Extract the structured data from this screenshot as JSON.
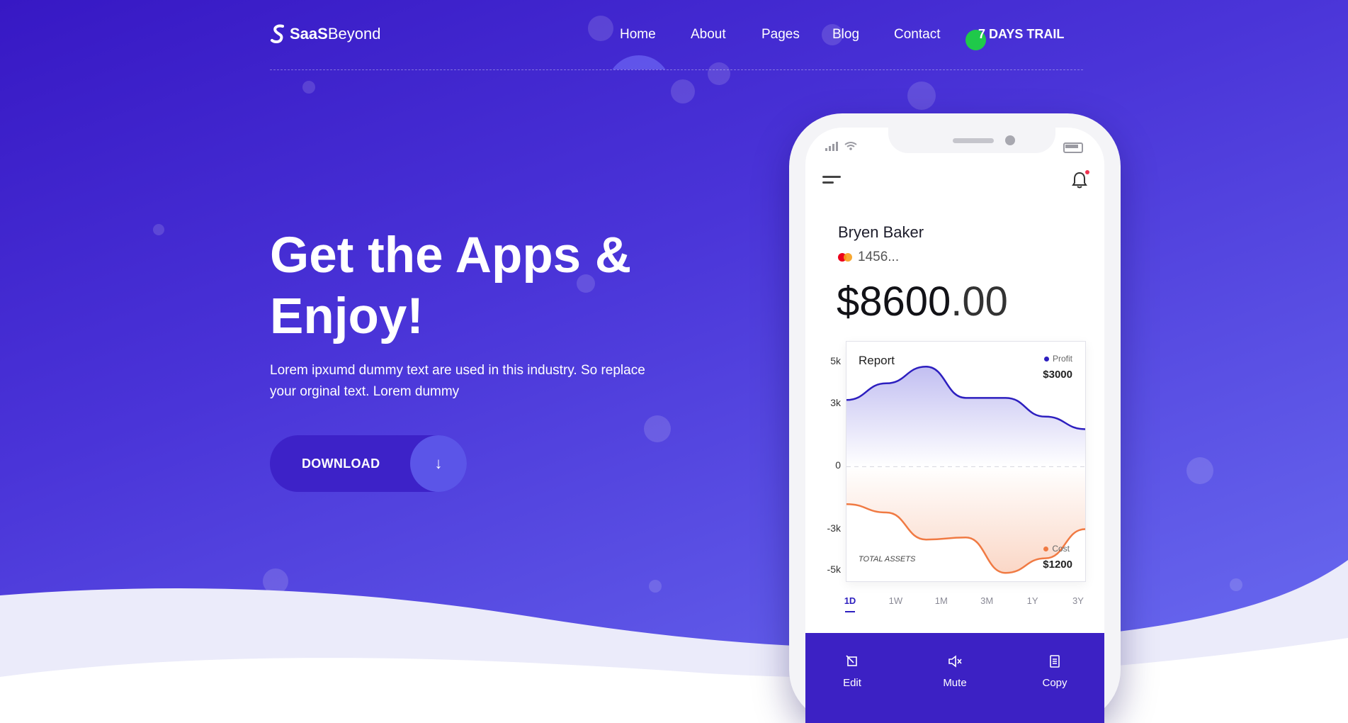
{
  "brand": {
    "bold": "SaaS",
    "light": "Beyond"
  },
  "nav": {
    "home": "Home",
    "about": "About",
    "pages": "Pages",
    "blog": "Blog",
    "contact": "Contact",
    "trial": "7 DAYS TRAIL"
  },
  "hero": {
    "title": "Get the Apps & Enjoy!",
    "description": "Lorem ipxumd dummy text are used in this industry. So replace your orginal text. Lorem dummy",
    "download_label": "DOWNLOAD",
    "download_icon": "↓"
  },
  "phone": {
    "user_name": "Bryen Baker",
    "card_number": "1456...",
    "balance_main": "$8600",
    "balance_cents": ".00",
    "report_title": "Report",
    "profit_label": "Profit",
    "profit_value": "$3000",
    "cost_label": "Cost",
    "cost_value": "$1200",
    "total_assets": "TOTAL ASSETS",
    "ranges": [
      "1D",
      "1W",
      "1M",
      "3M",
      "1Y",
      "3Y"
    ],
    "active_range": "1D",
    "actions": {
      "edit": "Edit",
      "mute": "Mute",
      "copy": "Copy"
    }
  },
  "colors": {
    "accent": "#3718c4",
    "profit": "#2d1fbf",
    "cost": "#f07a43",
    "trial_dot": "#1fc94a"
  },
  "chart_data": {
    "type": "area",
    "title": "Report",
    "ylim": [
      -5.5,
      6
    ],
    "yticks": [
      "5k",
      "3k",
      "0",
      "-3k",
      "-5k"
    ],
    "ytick_values": [
      5,
      3,
      0,
      -3,
      -5
    ],
    "x": [
      0,
      1,
      2,
      3,
      4,
      5,
      6
    ],
    "series": [
      {
        "name": "Profit",
        "values": [
          3.2,
          4.0,
          4.8,
          3.3,
          3.3,
          2.4,
          1.8
        ]
      },
      {
        "name": "Cost",
        "values": [
          -1.8,
          -2.2,
          -3.5,
          -3.4,
          -5.1,
          -4.4,
          -3.0
        ]
      }
    ]
  }
}
